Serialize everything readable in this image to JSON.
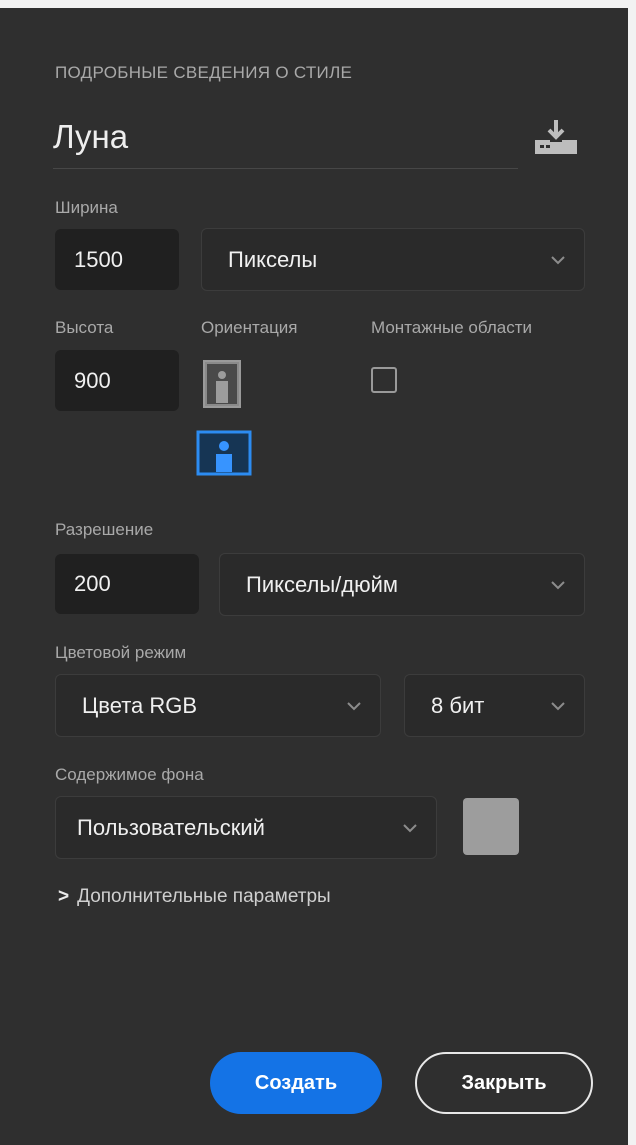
{
  "panel": {
    "section_title": "ПОДРОБНЫЕ СВЕДЕНИЯ О СТИЛЕ",
    "document_name": "Луна",
    "width": {
      "label": "Ширина",
      "value": "1500",
      "unit": "Пикселы"
    },
    "height": {
      "label": "Высота",
      "value": "900"
    },
    "orientation": {
      "label": "Ориентация",
      "selected": "landscape"
    },
    "artboards": {
      "label": "Монтажные области",
      "checked": false
    },
    "resolution": {
      "label": "Разрешение",
      "value": "200",
      "unit": "Пикселы/дюйм"
    },
    "color_mode": {
      "label": "Цветовой режим",
      "mode": "Цвета RGB",
      "depth": "8 бит"
    },
    "background": {
      "label": "Содержимое фона",
      "value": "Пользовательский",
      "swatch_color": "#9d9d9d"
    },
    "advanced_label": "Дополнительные параметры",
    "create_label": "Создать",
    "close_label": "Закрыть"
  },
  "colors": {
    "panel_bg": "#2f2f2f",
    "accent": "#1473e6",
    "field_bg": "#202020"
  },
  "icons": [
    "save-preset-icon",
    "portrait-icon",
    "landscape-icon",
    "chevron-down-icon",
    "chevron-right-icon"
  ]
}
